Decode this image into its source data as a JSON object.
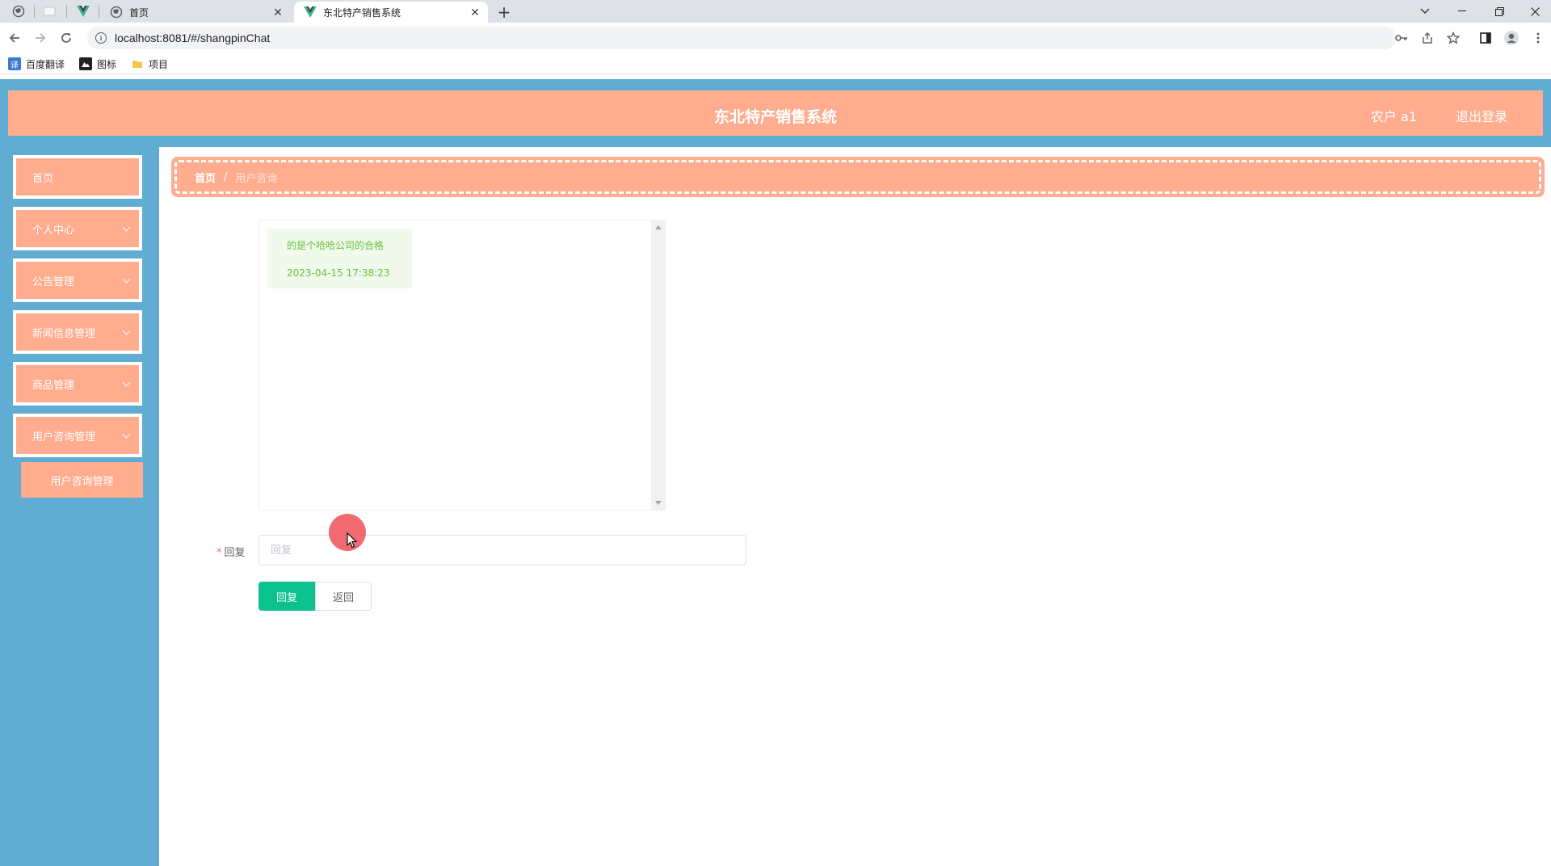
{
  "browser": {
    "tabs": [
      {
        "title": "首页",
        "active": false
      },
      {
        "title": "东北特产销售系统",
        "active": true
      }
    ],
    "url": "localhost:8081/#/shangpinChat",
    "bookmarks": [
      {
        "label": "百度翻译",
        "icon": "translate-icon",
        "color": "#3a7bd5"
      },
      {
        "label": "图标",
        "icon": "iconfont-icon",
        "color": "#222222"
      },
      {
        "label": "项目",
        "icon": "folder-icon",
        "color": "#f6c54d"
      }
    ]
  },
  "header": {
    "title": "东北特产销售系统",
    "user": "农户 a1",
    "logout": "退出登录"
  },
  "sidebar": {
    "items": [
      {
        "label": "首页",
        "has_arrow": false
      },
      {
        "label": "个人中心",
        "has_arrow": true
      },
      {
        "label": "公告管理",
        "has_arrow": true
      },
      {
        "label": "新闻信息管理",
        "has_arrow": true
      },
      {
        "label": "商品管理",
        "has_arrow": true
      },
      {
        "label": "用户咨询管理",
        "has_arrow": true
      }
    ],
    "submenu": {
      "label": "用户咨询管理"
    }
  },
  "breadcrumb": {
    "home": "首页",
    "separator": "/",
    "current": "用户咨询"
  },
  "chat": {
    "messages": [
      {
        "text": "的是个哈哈公司的合格",
        "time": "2023-04-15 17:38:23"
      }
    ]
  },
  "form": {
    "reply_label": "回复",
    "required_mark": "*",
    "reply_placeholder": "回复",
    "reply_value": ""
  },
  "buttons": {
    "reply": "回复",
    "back": "返回"
  },
  "colors": {
    "accent": "#ffac8f",
    "sidebar_bg": "#61acd3",
    "primary_button": "#0bc28f",
    "message_bg": "#f0f9eb",
    "message_text": "#67c23a"
  }
}
